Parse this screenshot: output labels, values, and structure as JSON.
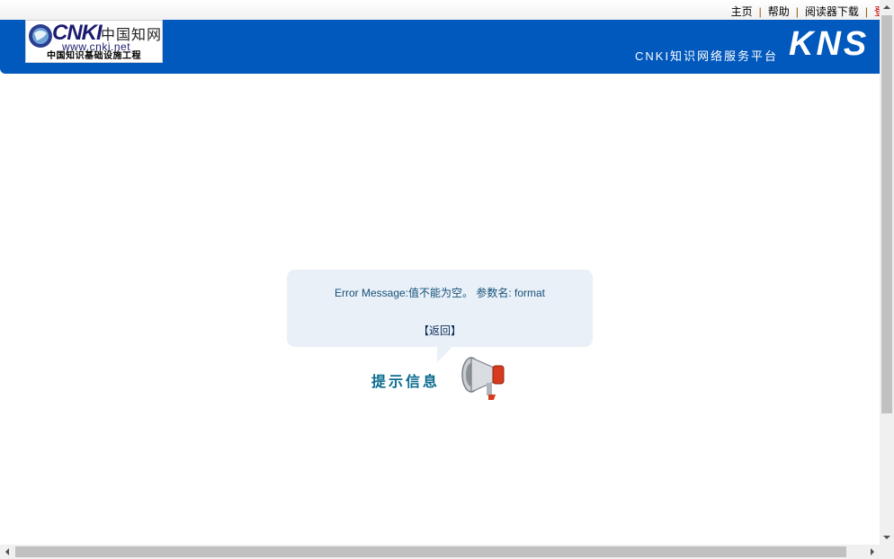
{
  "toplinks": {
    "home": "主页",
    "help": "帮助",
    "reader_download": "阅读器下载",
    "login": "登录",
    "separator": "|"
  },
  "header": {
    "logo_brand": "CNKI",
    "logo_cn": "中国知网",
    "logo_url": "www.cnki.net",
    "logo_subtitle": "中国知识基础设施工程",
    "platform_name": "CNKI知识网络服务平台",
    "product": "KNS"
  },
  "message": {
    "error_text": "Error Message:值不能为空。 参数名: format",
    "back_link": "【返回】",
    "hint_title": "提示信息"
  },
  "icons": {
    "logo_globe": "globe-icon",
    "megaphone": "megaphone-icon",
    "scroll_up": "arrow-up-icon",
    "scroll_down": "arrow-down-icon",
    "scroll_left": "arrow-left-icon",
    "scroll_right": "arrow-right-icon"
  },
  "colors": {
    "header_blue": "#0158bd",
    "message_bg": "#e9f0f7",
    "login_red": "#cc0000",
    "hint_teal": "#0a6b8e"
  }
}
